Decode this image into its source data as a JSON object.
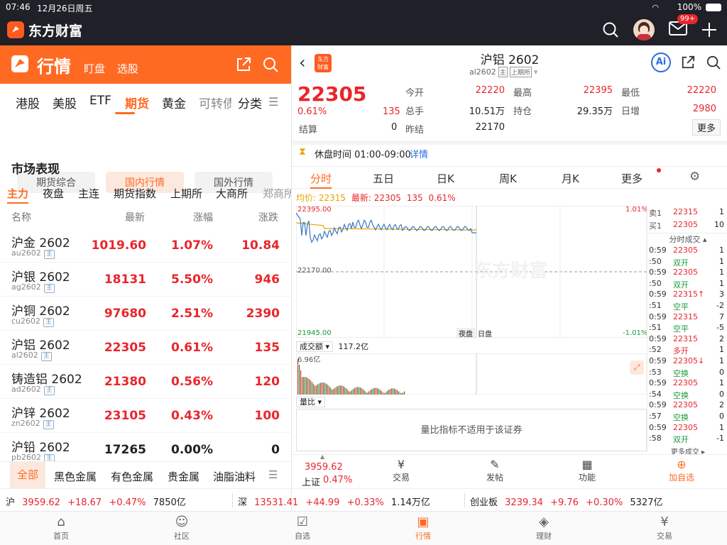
{
  "status": {
    "time": "07:46",
    "date": "12月26日周五",
    "battery": "100%"
  },
  "app": {
    "name": "东方财富",
    "badge": "99+"
  },
  "left": {
    "title": "行情",
    "sub1": "盯盘",
    "sub2": "选股",
    "tabs": [
      "港股",
      "美股",
      "ETF",
      "期货",
      "黄金",
      "可转债",
      "分类"
    ],
    "chips": [
      "期货综合",
      "国内行情",
      "国外行情"
    ],
    "section": "市场表现",
    "subtabs": [
      "主力",
      "夜盘",
      "主连",
      "期货指数",
      "上期所",
      "大商所",
      "郑商所"
    ],
    "cols": [
      "名称",
      "最新",
      "涨幅",
      "涨跌"
    ],
    "rows": [
      {
        "name": "沪金 2602",
        "code": "au2602",
        "tag": "主",
        "price": "1019.60",
        "pct": "1.07%",
        "chg": "10.84",
        "color": "red"
      },
      {
        "name": "沪银 2602",
        "code": "ag2602",
        "tag": "主",
        "price": "18131",
        "pct": "5.50%",
        "chg": "946",
        "color": "red"
      },
      {
        "name": "沪铜 2602",
        "code": "cu2602",
        "tag": "主",
        "price": "97680",
        "pct": "2.51%",
        "chg": "2390",
        "color": "red"
      },
      {
        "name": "沪铝 2602",
        "code": "al2602",
        "tag": "主",
        "price": "22305",
        "pct": "0.61%",
        "chg": "135",
        "color": "red"
      },
      {
        "name": "铸造铝 2602",
        "code": "ad2602",
        "tag": "主",
        "price": "21380",
        "pct": "0.56%",
        "chg": "120",
        "color": "red"
      },
      {
        "name": "沪锌 2602",
        "code": "zn2602",
        "tag": "主",
        "price": "23105",
        "pct": "0.43%",
        "chg": "100",
        "color": "red"
      },
      {
        "name": "沪铅 2602",
        "code": "pb2602",
        "tag": "主",
        "price": "17265",
        "pct": "0.00%",
        "chg": "0",
        "color": "black"
      }
    ],
    "cats": [
      "全部",
      "黑色金属",
      "有色金属",
      "贵金属",
      "油脂油料"
    ]
  },
  "right": {
    "title": "沪铝 2602",
    "code": "al2602",
    "tag1": "主",
    "tag2": "上期所",
    "ai": "Ai",
    "price": "22305",
    "pct": "0.61%",
    "chg": "135",
    "stats": [
      {
        "k": "今开",
        "v": "22220",
        "c": "red"
      },
      {
        "k": "最高",
        "v": "22395",
        "c": "red"
      },
      {
        "k": "最低",
        "v": "22220",
        "c": "red"
      },
      {
        "k": "总手",
        "v": "10.51万",
        "c": "black"
      },
      {
        "k": "持仓",
        "v": "29.35万",
        "c": "black"
      },
      {
        "k": "日增",
        "v": "2980",
        "c": "red"
      },
      {
        "k": "结算",
        "v": "0",
        "c": "black"
      },
      {
        "k": "昨结",
        "v": "22170",
        "c": "black"
      }
    ],
    "more": "更多",
    "break_label": "休盘时间 01:00-09:00",
    "detail": "详情",
    "ktabs": [
      "分时",
      "五日",
      "日K",
      "周K",
      "月K",
      "更多"
    ],
    "avg_label": "均价:",
    "avg": "22315",
    "latest_label": "最新:",
    "latest": "22305",
    "latest_chg": "135",
    "latest_pct": "0.61%",
    "chart": {
      "hi": "22395.00",
      "mid": "22170.00",
      "lo": "21945.00",
      "hi_pct": "1.01%",
      "lo_pct": "-1.01%",
      "night": "夜盘",
      "day": "日盘",
      "watermark": "东方财富"
    },
    "vol_label": "成交额",
    "vol_total": "117.2亿",
    "vol_max": "6.96亿",
    "ratio_label": "量比",
    "ratio_msg": "量比指标不适用于该证券",
    "ask": {
      "k": "卖1",
      "p": "22315",
      "v": "1"
    },
    "bid": {
      "k": "买1",
      "p": "22305",
      "v": "10"
    },
    "trades_title": "分时成交",
    "trades": [
      {
        "t": "0:59",
        "p": "22305",
        "v": "1",
        "pc": "red"
      },
      {
        "t": ":50",
        "p": "双开",
        "v": "1",
        "pc": "green"
      },
      {
        "t": "0:59",
        "p": "22305",
        "v": "1",
        "pc": "red"
      },
      {
        "t": ":50",
        "p": "双开",
        "v": "1",
        "pc": "green"
      },
      {
        "t": "0:59",
        "p": "22315↑",
        "v": "3",
        "pc": "red"
      },
      {
        "t": ":51",
        "p": "空平",
        "v": "-2",
        "pc": "green"
      },
      {
        "t": "0:59",
        "p": "22315",
        "v": "7",
        "pc": "red"
      },
      {
        "t": ":51",
        "p": "空平",
        "v": "-5",
        "pc": "green"
      },
      {
        "t": "0:59",
        "p": "22315",
        "v": "2",
        "pc": "red"
      },
      {
        "t": ":52",
        "p": "多开",
        "v": "1",
        "pc": "red"
      },
      {
        "t": "0:59",
        "p": "22305↓",
        "v": "1",
        "pc": "red"
      },
      {
        "t": ":53",
        "p": "空换",
        "v": "0",
        "pc": "green"
      },
      {
        "t": "0:59",
        "p": "22305",
        "v": "1",
        "pc": "red"
      },
      {
        "t": ":54",
        "p": "空换",
        "v": "0",
        "pc": "green"
      },
      {
        "t": "0:59",
        "p": "22305",
        "v": "2",
        "pc": "red"
      },
      {
        "t": ":57",
        "p": "空换",
        "v": "0",
        "pc": "green"
      },
      {
        "t": "0:59",
        "p": "22305",
        "v": "1",
        "pc": "red"
      },
      {
        "t": ":58",
        "p": "双开",
        "v": "-1",
        "pc": "green"
      }
    ],
    "trades_more": "更多成交",
    "bottom": {
      "index_val": "3959.62",
      "index_name": "上证",
      "index_pct": "0.47%",
      "items": [
        "交易",
        "发帖",
        "功能",
        "加自选"
      ]
    }
  },
  "indexbar": [
    {
      "name": "沪",
      "val": "3959.62",
      "chg": "+18.67",
      "pct": "+0.47%",
      "amt": "7850亿"
    },
    {
      "name": "深",
      "val": "13531.41",
      "chg": "+44.99",
      "pct": "+0.33%",
      "amt": "1.14万亿"
    },
    {
      "name": "创业板",
      "val": "3239.34",
      "chg": "+9.76",
      "pct": "+0.30%",
      "amt": "5327亿"
    }
  ],
  "nav": [
    "首页",
    "社区",
    "自选",
    "行情",
    "理财",
    "交易"
  ]
}
